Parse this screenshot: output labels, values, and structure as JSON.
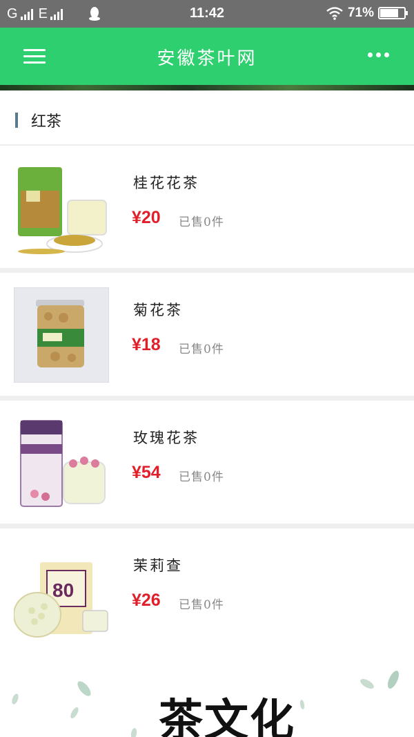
{
  "status_bar": {
    "carrier_1": "G",
    "carrier_2": "E",
    "time": "11:42",
    "battery": "71%",
    "battery_level": 0.71,
    "icons": [
      "signal-icon",
      "qq-icon",
      "wifi-icon",
      "battery-icon"
    ]
  },
  "nav": {
    "title": "安徽茶叶网",
    "menu_icon": "menu-icon",
    "more_icon": "more-icon"
  },
  "section": {
    "title": "红茶"
  },
  "products": [
    {
      "name": "桂花花茶",
      "price": "¥20",
      "sold": "已售0件"
    },
    {
      "name": "菊花茶",
      "price": "¥18",
      "sold": "已售0件"
    },
    {
      "name": "玫瑰花茶",
      "price": "¥54",
      "sold": "已售0件"
    },
    {
      "name": "茉莉查",
      "price": "¥26",
      "sold": "已售0件"
    }
  ],
  "footer": {
    "title": "茶文化"
  },
  "colors": {
    "nav_green": "#2ecf6f",
    "price_red": "#e01f2b",
    "status_gray": "#6e6e6e"
  }
}
